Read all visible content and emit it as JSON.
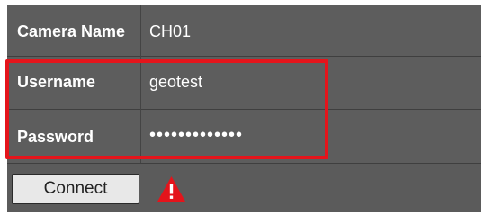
{
  "form": {
    "camera_name_label": "Camera Name",
    "camera_name_value": "CH01",
    "username_label": "Username",
    "username_value": "geotest",
    "password_label": "Password",
    "password_value": "•••••••••••••"
  },
  "actions": {
    "connect_label": "Connect"
  },
  "icons": {
    "warning": "warning-triangle-icon"
  },
  "colors": {
    "panel_bg": "#5b5b5b",
    "highlight_border": "#e4141b",
    "warning_fill": "#e4141b",
    "button_bg": "#e8e8e8"
  }
}
